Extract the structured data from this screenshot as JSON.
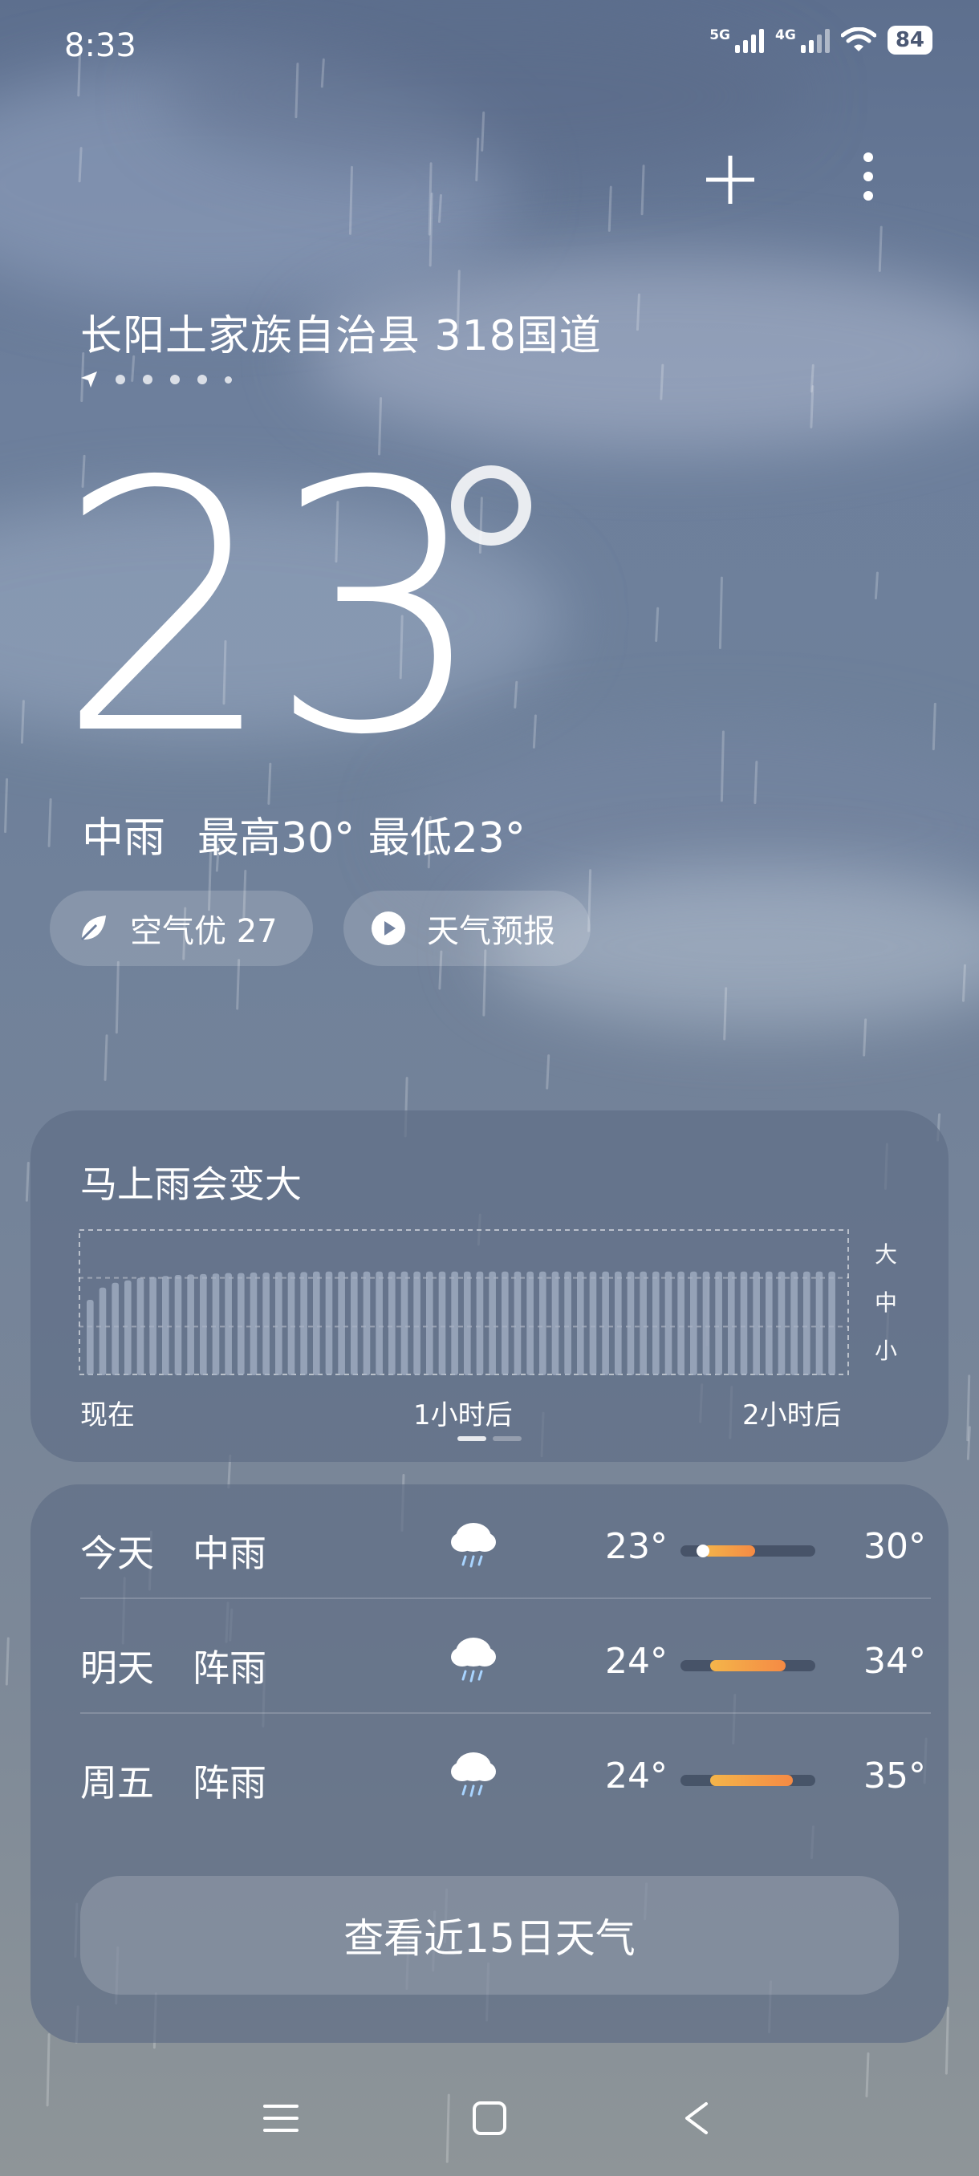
{
  "status_bar": {
    "time": "8:33",
    "net1": "5G",
    "net2": "4G",
    "battery": "84"
  },
  "header": {
    "add_icon": "plus-icon",
    "more_icon": "more-vertical-icon"
  },
  "location": {
    "name": "长阳土家族自治县 318国道",
    "page_count": 6,
    "current_page": 1
  },
  "current": {
    "temperature": "23",
    "condition": "中雨",
    "high": "最高30°",
    "low": "最低23°"
  },
  "pills": {
    "aqi": "空气优 27",
    "forecast": "天气预报"
  },
  "precip_card": {
    "title": "马上雨会变大",
    "x_labels": [
      "现在",
      "1小时后",
      "2小时后"
    ],
    "y_labels": [
      "大",
      "中",
      "小"
    ]
  },
  "chart_data": {
    "type": "bar",
    "title": "马上雨会变大",
    "x_tick_labels": [
      "现在",
      "1小时后",
      "2小时后"
    ],
    "y_tick_labels": [
      "小",
      "中",
      "大"
    ],
    "ylim": [
      0,
      3
    ],
    "values": [
      1.55,
      1.8,
      1.9,
      1.95,
      2.0,
      2.02,
      2.04,
      2.06,
      2.07,
      2.08,
      2.09,
      2.1,
      2.1,
      2.11,
      2.11,
      2.12,
      2.12,
      2.12,
      2.13,
      2.13,
      2.13,
      2.13,
      2.13,
      2.13,
      2.13,
      2.13,
      2.13,
      2.13,
      2.13,
      2.13,
      2.13,
      2.13,
      2.13,
      2.13,
      2.13,
      2.13,
      2.13,
      2.13,
      2.13,
      2.13,
      2.13,
      2.13,
      2.13,
      2.13,
      2.13,
      2.13,
      2.13,
      2.13,
      2.13,
      2.13,
      2.13,
      2.13,
      2.13,
      2.13,
      2.13,
      2.13,
      2.13,
      2.13,
      2.13,
      2.13
    ]
  },
  "forecast": {
    "days": [
      {
        "day": "今天",
        "condition": "中雨",
        "icon": "rain-cloud-icon",
        "low": "23°",
        "high": "30°",
        "low_val": 23,
        "high_val": 30,
        "current_val": 23
      },
      {
        "day": "明天",
        "condition": "阵雨",
        "icon": "rain-cloud-icon",
        "low": "24°",
        "high": "34°",
        "low_val": 24,
        "high_val": 34
      },
      {
        "day": "周五",
        "condition": "阵雨",
        "icon": "rain-cloud-icon",
        "low": "24°",
        "high": "35°",
        "low_val": 24,
        "high_val": 35
      }
    ],
    "range_min": 20,
    "range_max": 38,
    "button": "查看近15日天气"
  },
  "navbar": {
    "menu_icon": "menu-icon",
    "home_icon": "home-square-icon",
    "back_icon": "back-chevron-icon"
  }
}
